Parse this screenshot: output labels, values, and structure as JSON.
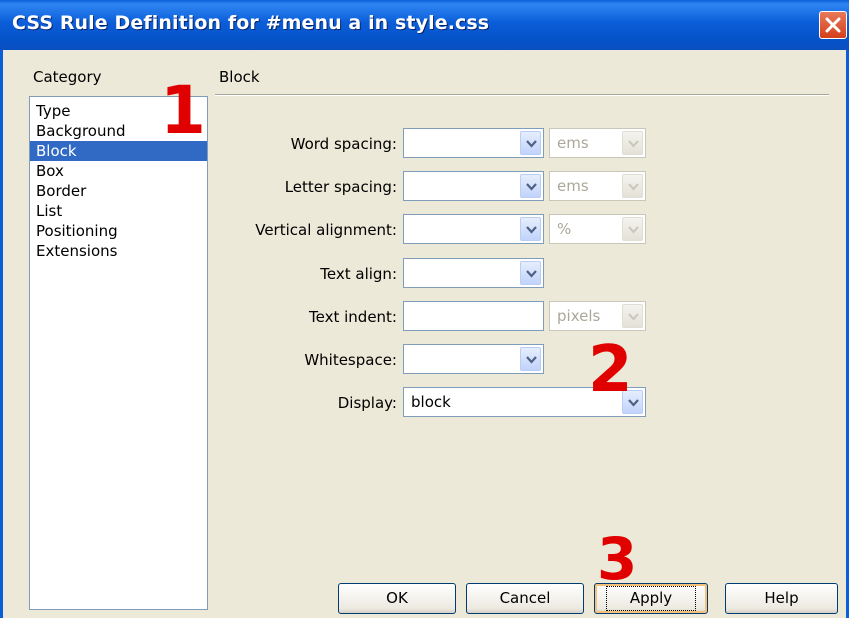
{
  "window": {
    "title": "CSS Rule Definition for #menu a in style.css"
  },
  "category": {
    "heading": "Category",
    "items": [
      "Type",
      "Background",
      "Block",
      "Box",
      "Border",
      "List",
      "Positioning",
      "Extensions"
    ],
    "selected": "Block"
  },
  "panel": {
    "heading": "Block"
  },
  "fields": {
    "word_spacing": {
      "label": "Word spacing:",
      "value": "",
      "unit": "ems"
    },
    "letter_spacing": {
      "label": "Letter spacing:",
      "value": "",
      "unit": "ems"
    },
    "vertical_alignment": {
      "label": "Vertical alignment:",
      "value": "",
      "unit": "%"
    },
    "text_align": {
      "label": "Text align:",
      "value": ""
    },
    "text_indent": {
      "label": "Text indent:",
      "value": "",
      "unit": "pixels"
    },
    "whitespace": {
      "label": "Whitespace:",
      "value": ""
    },
    "display": {
      "label": "Display:",
      "value": "block"
    }
  },
  "buttons": {
    "ok": "OK",
    "cancel": "Cancel",
    "apply": "Apply",
    "help": "Help"
  },
  "annotations": {
    "step1": "1",
    "step2": "2",
    "step3": "3"
  },
  "colors": {
    "title_bar": "#0b5ed9",
    "selection": "#316ac5",
    "annotation": "#e00000",
    "dialog_bg": "#ece9d8"
  }
}
